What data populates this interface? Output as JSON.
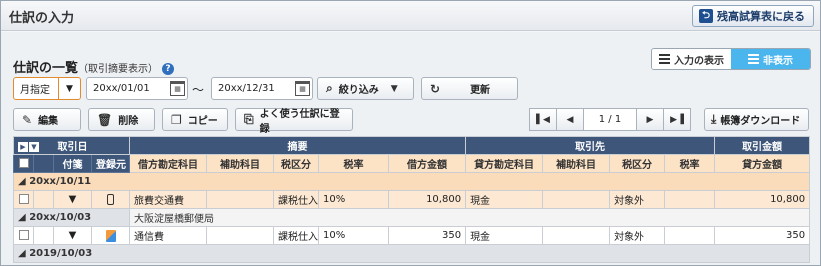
{
  "app": {
    "title": "仕訳の入力",
    "back_label": "残高試算表に戻る"
  },
  "section": {
    "title": "仕訳の一覧",
    "subtitle": "（取引摘要表示）"
  },
  "view_toggle": {
    "show_label": "入力の表示",
    "hide_label": "非表示",
    "active": "hide"
  },
  "filters": {
    "period_label": "月指定",
    "date_from": "20xx/01/01",
    "date_to": "20xx/12/31",
    "tilde": "～",
    "filter_label": "絞り込み",
    "refresh_label": "更新"
  },
  "toolbar": {
    "edit_label": "編集",
    "delete_label": "削除",
    "copy_label": "コピー",
    "register_label": "よく使う仕訳に登録"
  },
  "pager": {
    "page_text": "1 / 1"
  },
  "download_label": "帳簿ダウンロード",
  "table": {
    "header1": {
      "date": "取引日",
      "memo": "摘要",
      "partner": "取引先",
      "amount": "取引金額"
    },
    "header2": {
      "attach": "付箋",
      "source": "登録元",
      "debit_account": "借方勘定科目",
      "debit_sub": "補助科目",
      "debit_tax_class": "税区分",
      "debit_tax_rate": "税率",
      "debit_amount": "借方金額",
      "credit_account": "貸方勘定科目",
      "credit_sub": "補助科目",
      "credit_tax_class": "税区分",
      "credit_tax_rate": "税率",
      "credit_amount": "貸方金額"
    },
    "groups": [
      {
        "date": "20xx/10/11",
        "memo": "",
        "selected": true,
        "rows": [
          {
            "debit_account": "旅費交通費",
            "debit_sub": "",
            "debit_tax_class": "課税仕入",
            "debit_tax_rate": "10%",
            "debit_amount": "10,800",
            "credit_account": "現金",
            "credit_sub": "",
            "credit_tax_class": "対象外",
            "credit_tax_rate": "",
            "credit_amount": "10,800",
            "source_icon": "phone-icon"
          }
        ]
      },
      {
        "date": "20xx/10/03",
        "memo": "大阪淀屋橋郵便局",
        "selected": false,
        "rows": [
          {
            "debit_account": "通信費",
            "debit_sub": "",
            "debit_tax_class": "課税仕入",
            "debit_tax_rate": "10%",
            "debit_amount": "350",
            "credit_account": "現金",
            "credit_sub": "",
            "credit_tax_class": "対象外",
            "credit_tax_rate": "",
            "credit_amount": "350",
            "source_icon": "doc-icon"
          }
        ]
      }
    ],
    "partial_next_date": "2019/10/03"
  },
  "colors": {
    "header_dark": "#3d5679",
    "header_light": "#fde3c6",
    "accent_blue": "#4bb6ee",
    "selected_row": "#fde9d3"
  }
}
